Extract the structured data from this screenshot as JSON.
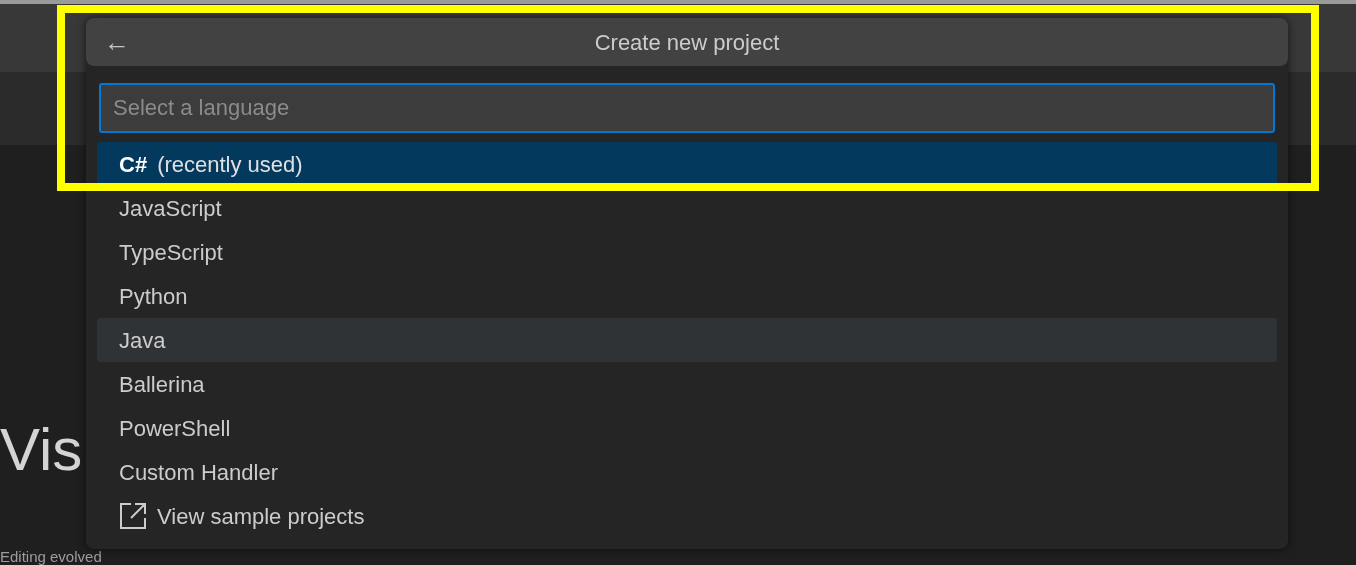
{
  "background": {
    "heading": "Vis",
    "subheading": "Editing evolved"
  },
  "quick_pick": {
    "title": "Create new project",
    "back_button": "←",
    "input": {
      "placeholder": "Select a language"
    },
    "items": [
      {
        "kind": "language",
        "label": "C#",
        "description": "(recently used)",
        "selected": true,
        "hovered": false
      },
      {
        "kind": "language",
        "label": "JavaScript",
        "selected": false,
        "hovered": false
      },
      {
        "kind": "language",
        "label": "TypeScript",
        "selected": false,
        "hovered": false
      },
      {
        "kind": "language",
        "label": "Python",
        "selected": false,
        "hovered": false
      },
      {
        "kind": "language",
        "label": "Java",
        "selected": false,
        "hovered": true
      },
      {
        "kind": "language",
        "label": "Ballerina",
        "selected": false,
        "hovered": false
      },
      {
        "kind": "language",
        "label": "PowerShell",
        "selected": false,
        "hovered": false
      },
      {
        "kind": "language",
        "label": "Custom Handler",
        "selected": false,
        "hovered": false
      },
      {
        "kind": "link",
        "label": "View sample projects",
        "selected": false,
        "hovered": false
      }
    ]
  },
  "highlight": {
    "kind": "box"
  }
}
